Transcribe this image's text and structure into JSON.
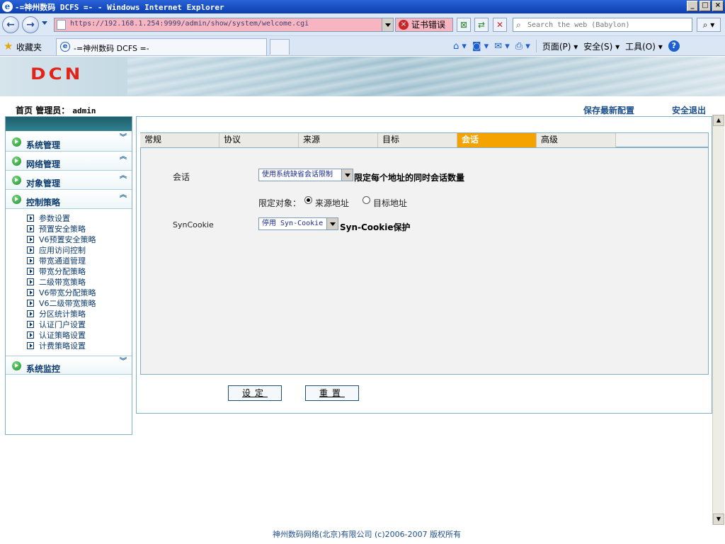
{
  "window": {
    "title": "-=神州数码 DCFS =- - Windows Internet Explorer",
    "buttons": [
      "_",
      "□",
      "×"
    ]
  },
  "browser": {
    "url": "https://192.168.1.254:9999/admin/show/system/welcome.cgi",
    "cert_error": "证书错误",
    "search_placeholder": "Search the web (Babylon)",
    "favorites_label": "收藏夹",
    "tab_title": "-=神州数码 DCFS =-",
    "commands": {
      "page": "页面(P)",
      "safety": "安全(S)",
      "tools": "工具(O)"
    }
  },
  "app": {
    "logo_text": "DCN",
    "breadcrumb": {
      "home": "首页",
      "admin_label": "管理员：",
      "admin_user": "admin"
    },
    "top_links": {
      "save_config": "保存最新配置",
      "logout": "安全退出"
    }
  },
  "sidebar": {
    "groups": [
      {
        "label": "系统管理",
        "state": "collapsed"
      },
      {
        "label": "网络管理",
        "state": "expanded"
      },
      {
        "label": "对象管理",
        "state": "expanded"
      },
      {
        "label": "控制策略",
        "state": "expanded"
      }
    ],
    "items": [
      "参数设置",
      "预置安全策略",
      "V6预置安全策略",
      "应用访问控制",
      "带宽通道管理",
      "带宽分配策略",
      "二级带宽策略",
      "V6带宽分配策略",
      "V6二级带宽策略",
      "分区统计策略",
      "认证门户设置",
      "认证策略设置",
      "计费策略设置"
    ],
    "last_group": {
      "label": "系统监控",
      "state": "collapsed"
    }
  },
  "tabs": [
    "常规",
    "协议",
    "来源",
    "目标",
    "会话",
    "高级"
  ],
  "active_tab": "会话",
  "form": {
    "session_label": "会话",
    "session_select": "使用系统缺省会话限制",
    "session_desc": "限定每个地址的同时会话数量",
    "target_label": "限定对象：",
    "radio_source": "来源地址",
    "radio_dest": "目标地址",
    "syncookie_label": "SynCookie",
    "syncookie_select": "停用 Syn-Cookie",
    "syncookie_desc": "Syn-Cookie保护",
    "set_button": "设定",
    "reset_button": "重置"
  },
  "footer": "神州数码网络(北京)有限公司 (c)2006-2007 版权所有"
}
